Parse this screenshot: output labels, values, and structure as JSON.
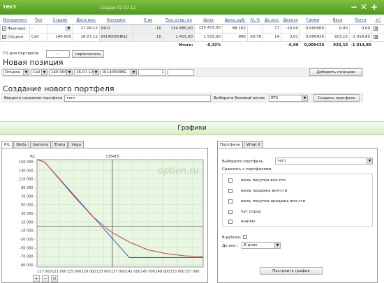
{
  "portfolio": {
    "name": "тест",
    "created": "Создан 02.07.12",
    "icons": [
      "minus-icon",
      "close-icon",
      "plus-icon"
    ]
  },
  "positions_table": {
    "headers": [
      "Инструмент",
      "Тип",
      "Страйк",
      "Дата исп.",
      "Контракт",
      "К-во",
      "Поз. откр. по",
      "Цена",
      "Цена, руб.",
      "IV, %",
      "До исп.",
      "Дельта",
      "Гамма",
      "Вега",
      "Тетта",
      "+/-"
    ],
    "rows": [
      {
        "instrument": "Фьючерс",
        "type": "-",
        "strike": "",
        "date": "17.09.12",
        "contract": "RIU2",
        "qty": "-10",
        "opened": "134 880,00",
        "price": "135 415,00",
        "price_rub": "88.162",
        "iv": "-",
        "days": "77",
        "delta": "-10,00",
        "gamma": "0,000000",
        "vega": "0,00",
        "theta": "0,00"
      },
      {
        "instrument": "Опцион",
        "type": "Call",
        "strike": "140 000",
        "date": "16.07.12",
        "contract": "RI140000BG2",
        "qty": "10",
        "opened": "1 415,00",
        "price": "1 515,00",
        "price_rub": "986",
        "iv": "30,78",
        "days": "14",
        "delta": "3,01",
        "gamma": "0,000426",
        "vega": "923,15",
        "theta": "-1 014,80"
      }
    ],
    "total": {
      "label": "Итого:",
      "value": "-0,32%",
      "delta": "-6,99",
      "gamma": "0,000426",
      "vega": "923,15",
      "theta": "-1 014,80"
    }
  },
  "go": {
    "label": "ГО для портфеля:",
    "value": "--",
    "recalc": "пересчитать"
  },
  "new_position": {
    "title": "Новая позиция",
    "type": "Опцион",
    "kind": "Call",
    "strike": "140 000",
    "date": "16.07.12",
    "contract": "RI140000BG",
    "qty": "1",
    "add": "Добавить позицию"
  },
  "new_portfolio": {
    "title": "Создание нового портфеля",
    "name_label": "Введите название портфеля",
    "name_value": "тест",
    "asset_label": "Выберите базовый актив",
    "asset_value": "RTS",
    "create": "Создать портфель"
  },
  "charts_title": "Графики",
  "chart_tabs": [
    "P/L",
    "Delta",
    "Gamma",
    "Theta",
    "Vega"
  ],
  "chart_data": {
    "type": "line",
    "title": "P/L",
    "marker_label": "135415",
    "marker_x": 135415,
    "watermark": "option.ru",
    "x_ticks": [
      "117 000",
      "121 000",
      "125 000",
      "129 000",
      "133 000",
      "137 000",
      "141 000",
      "145 000",
      "149 000",
      "153 000",
      "157 000"
    ],
    "y_ticks": [
      "150 000 -",
      "130 000 -",
      "110 000 -",
      "90 000 -",
      "70 000 -",
      "50 000 -",
      "30 000 -",
      "10 000 -",
      "-10 000 -",
      "-30 000 -",
      "-50 000 -",
      "-70 000 -",
      "-90 000 -"
    ],
    "xlim": [
      115000,
      160000
    ],
    "ylim": [
      -95000,
      155000
    ],
    "series": [
      {
        "color": "#3a58d0",
        "x": [
          115000,
          117000,
          140000,
          160000
        ],
        "y": [
          155000,
          150000,
          -73000,
          -73000
        ]
      },
      {
        "color": "#d04040",
        "x": [
          115000,
          117000,
          125000,
          130000,
          135000,
          140000,
          145000,
          150000,
          155000,
          160000
        ],
        "y": [
          155000,
          150000,
          70000,
          23000,
          -13000,
          -37000,
          -55000,
          -64000,
          -69000,
          -71000
        ]
      }
    ]
  },
  "chart_tools": [
    "zoom-in-icon",
    "zoom-out-icon",
    "zoom-reset-icon"
  ],
  "right_tabs": [
    "Портфель",
    "What if"
  ],
  "right_panel": {
    "select_label": "Выберите портфель",
    "select_value": "тест",
    "compare_label": "Сравнить с портфелями",
    "options": [
      "июль покупка вол-сти",
      "июль продажа вол-сти",
      "июль покупка-продажа вол-сти",
      "пут спрэд",
      "анализ"
    ],
    "rub_label": "В рублях:",
    "until_label": "До исп.:",
    "until_value": "В днях",
    "build": "Построить график"
  }
}
